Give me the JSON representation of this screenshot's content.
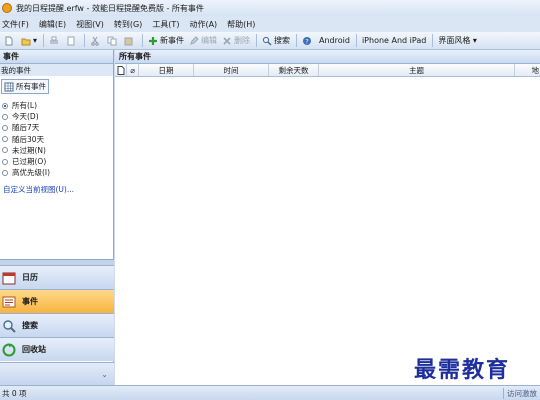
{
  "window": {
    "title": "我的日程提醒.erfw - 效能日程提醒免费版 - 所有事件"
  },
  "menu": [
    "文件(F)",
    "编辑(E)",
    "视图(V)",
    "转到(G)",
    "工具(T)",
    "动作(A)",
    "帮助(H)"
  ],
  "toolbar": {
    "new_event": "新事件",
    "edit": "编辑",
    "delete": "删除",
    "search": "搜索",
    "android": "Android",
    "iphone": "iPhone And iPad",
    "theme": "界面风格"
  },
  "left": {
    "header": "事件",
    "subheader": "我的事件",
    "all_events": "所有事件",
    "filters": [
      {
        "label": "所有(L)",
        "selected": true
      },
      {
        "label": "今天(D)",
        "selected": false
      },
      {
        "label": "随后7天",
        "selected": false
      },
      {
        "label": "随后30天",
        "selected": false
      },
      {
        "label": "未过期(N)",
        "selected": false
      },
      {
        "label": "已过期(O)",
        "selected": false
      },
      {
        "label": "高优先级(I)",
        "selected": false
      }
    ],
    "custom_view": "自定义当前视图(U)...",
    "nav": {
      "calendar": "日历",
      "events": "事件",
      "search": "搜索",
      "recycle": "回收站"
    }
  },
  "right": {
    "header": "所有事件",
    "columns": [
      "日期",
      "时间",
      "剩余天数",
      "主题",
      "地"
    ]
  },
  "status": {
    "count": "共 0 项",
    "right": "访问激放"
  },
  "watermark": "最需教育",
  "colors": {
    "accent": "#2a6bd0",
    "active_nav": "#f7b440"
  }
}
